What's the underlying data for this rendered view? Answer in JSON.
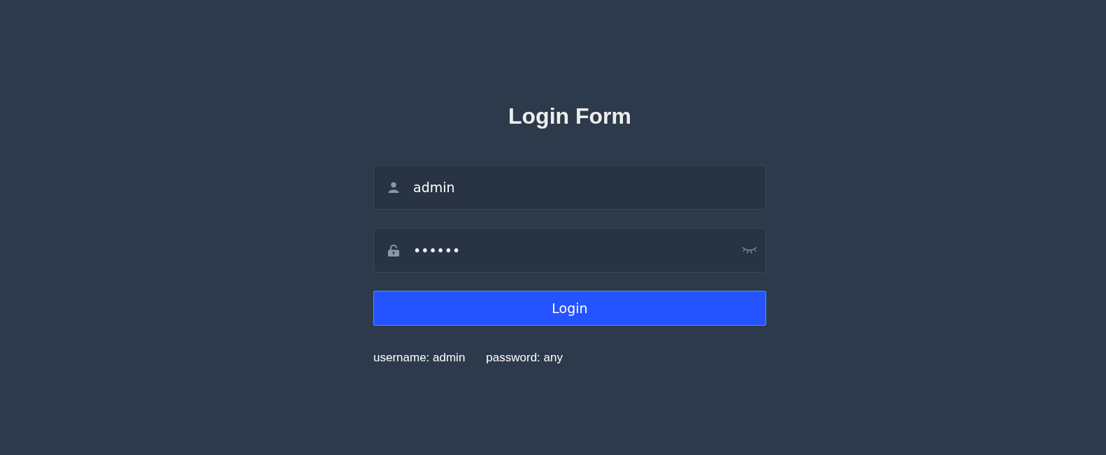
{
  "title": "Login Form",
  "username": {
    "value": "admin"
  },
  "password": {
    "value": "••••••",
    "visible": false
  },
  "login_button": "Login",
  "tips": [
    "username: admin",
    "password: any"
  ]
}
